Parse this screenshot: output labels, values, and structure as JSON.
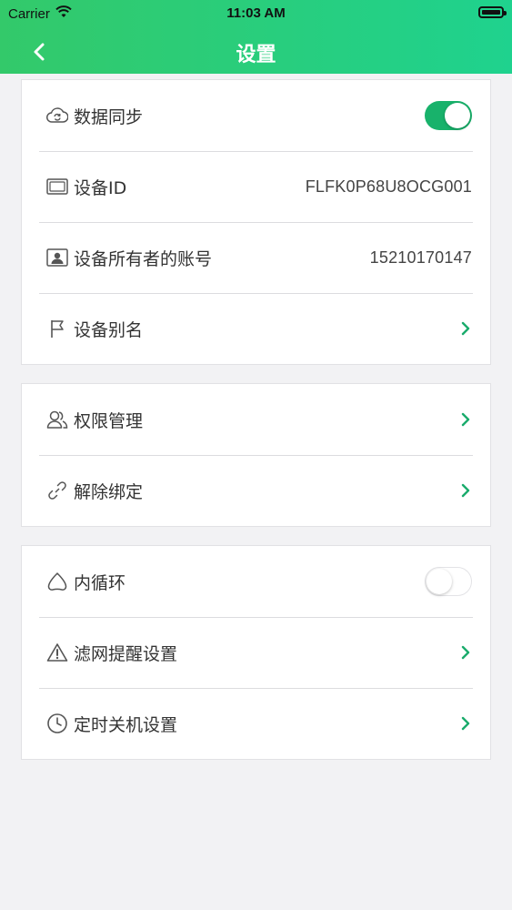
{
  "status_bar": {
    "carrier": "Carrier",
    "time": "11:03 AM",
    "wifi_icon": "wifi-icon",
    "battery_icon": "battery-icon"
  },
  "nav": {
    "title": "设置",
    "back_icon": "chevron-left-icon"
  },
  "colors": {
    "header_gradient_start": "#33c96a",
    "header_gradient_end": "#1fd28e",
    "accent": "#18b26b",
    "background": "#f2f2f4"
  },
  "group1": {
    "items": [
      {
        "label": "数据同步",
        "icon": "cloud-sync-icon",
        "toggle_on": true
      },
      {
        "label": "设备ID",
        "icon": "device-icon",
        "value": "FLFK0P68U8OCG001"
      },
      {
        "label": "设备所有者的账号",
        "icon": "id-card-icon",
        "value": "15210170147"
      },
      {
        "label": "设备别名",
        "icon": "flag-icon",
        "chevron": true
      }
    ]
  },
  "group2": {
    "items": [
      {
        "label": "权限管理",
        "icon": "users-icon",
        "chevron": true
      },
      {
        "label": "解除绑定",
        "icon": "link-icon",
        "chevron": true
      }
    ]
  },
  "group3": {
    "items": [
      {
        "label": "内循环",
        "icon": "airflow-icon",
        "toggle_on": false
      },
      {
        "label": "滤网提醒设置",
        "icon": "warning-icon",
        "chevron": true
      },
      {
        "label": "定时关机设置",
        "icon": "clock-icon",
        "chevron": true
      }
    ]
  }
}
